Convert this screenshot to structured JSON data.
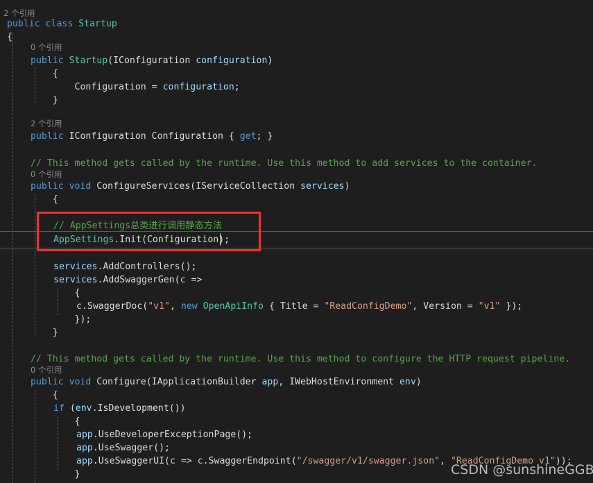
{
  "editor": {
    "language": "csharp",
    "background": "#1E1E1E",
    "colors": {
      "keyword": "#569CD6",
      "type": "#4EC9B0",
      "plain": "#DCDCDC",
      "variable": "#9CDCFE",
      "string": "#D69D85",
      "comment": "#57A64A",
      "codelens": "#8A8A8A",
      "annotation_box": "#F2312C",
      "indent_guide": "#5A5A5A",
      "current_line_border": "#5A5A5A"
    }
  },
  "codelens": {
    "class_startup": "2 个引用",
    "ctor_startup": "0 个引用",
    "prop_configuration": "2 个引用",
    "method_configure_services": "0 个引用",
    "method_configure": "0 个引用"
  },
  "code": {
    "l01": {
      "kw": "public class ",
      "type": "Startup"
    },
    "l02": "{",
    "l03": {
      "kw": "public ",
      "type": "Startup",
      "pun": "(",
      "ptype": "IConfiguration ",
      "var": "configuration",
      "pun2": ")"
    },
    "l04": "    {",
    "l05": {
      "pln": "        Configuration = ",
      "var": "configuration",
      "pun": ";"
    },
    "l06": "    }",
    "l07": {
      "kw": "public ",
      "pln": "IConfiguration Configuration { ",
      "kw2": "get",
      "pun": "; }"
    },
    "l08": {
      "cmt": "// This method gets called by the runtime. Use this method to add services to the container."
    },
    "l09": {
      "kw": "public void ",
      "pln": "ConfigureServices(IServiceCollection ",
      "var": "services",
      "pun": ")"
    },
    "l10": "    {",
    "l11": {
      "cmt": "// AppSettings总类进行调用静态方法"
    },
    "l12": {
      "type": "AppSettings",
      "pln": ".Init(Configuration);"
    },
    "l13": {
      "var": "services",
      "pln": ".AddControllers();"
    },
    "l14": {
      "var": "services",
      "pln": ".AddSwaggerGen(",
      "var2": "c",
      "pln2": " =>"
    },
    "l15": "        {",
    "l16": {
      "var": "c",
      "pln": ".SwaggerDoc(",
      "str": "\"v1\"",
      "pln2": ", ",
      "kw": "new ",
      "type": "OpenApiInfo",
      "pln3": " { Title = ",
      "str2": "\"ReadConfigDemo\"",
      "pln4": ", Version = ",
      "str3": "\"v1\"",
      "pln5": " });"
    },
    "l17": "        });",
    "l18": "    }",
    "l19": {
      "cmt": "// This method gets called by the runtime. Use this method to configure the HTTP request pipeline."
    },
    "l20": {
      "kw": "public void ",
      "pln": "Configure(IApplicationBuilder ",
      "var": "app",
      "pln2": ", IWebHostEnvironment ",
      "var2": "env",
      "pun": ")"
    },
    "l21": "    {",
    "l22": {
      "kw": "if ",
      "pun": "(",
      "var": "env",
      "pln": ".IsDevelopment())"
    },
    "l23": "        {",
    "l24": {
      "var": "app",
      "pln": ".UseDeveloperExceptionPage();"
    },
    "l25": {
      "var": "app",
      "pln": ".UseSwagger();"
    },
    "l26": {
      "var": "app",
      "pln": ".UseSwaggerUI(",
      "var2": "c",
      "pln2": " => ",
      "var3": "c",
      "pln3": ".SwaggerEndpoint(",
      "str": "\"/swagger/v1/swagger.json\"",
      "pln4": ", ",
      "str2": "\"ReadConfigDemo v1\"",
      "pln5": "));"
    },
    "l27": "        }"
  },
  "annotation": {
    "label": "red-highlight-rectangle",
    "color": "#F2312C",
    "covers_lines": [
      "// AppSettings总类进行调用静态方法",
      "AppSettings.Init(Configuration);"
    ]
  },
  "watermark": {
    "text": "CSDN @sunshineGGB"
  }
}
